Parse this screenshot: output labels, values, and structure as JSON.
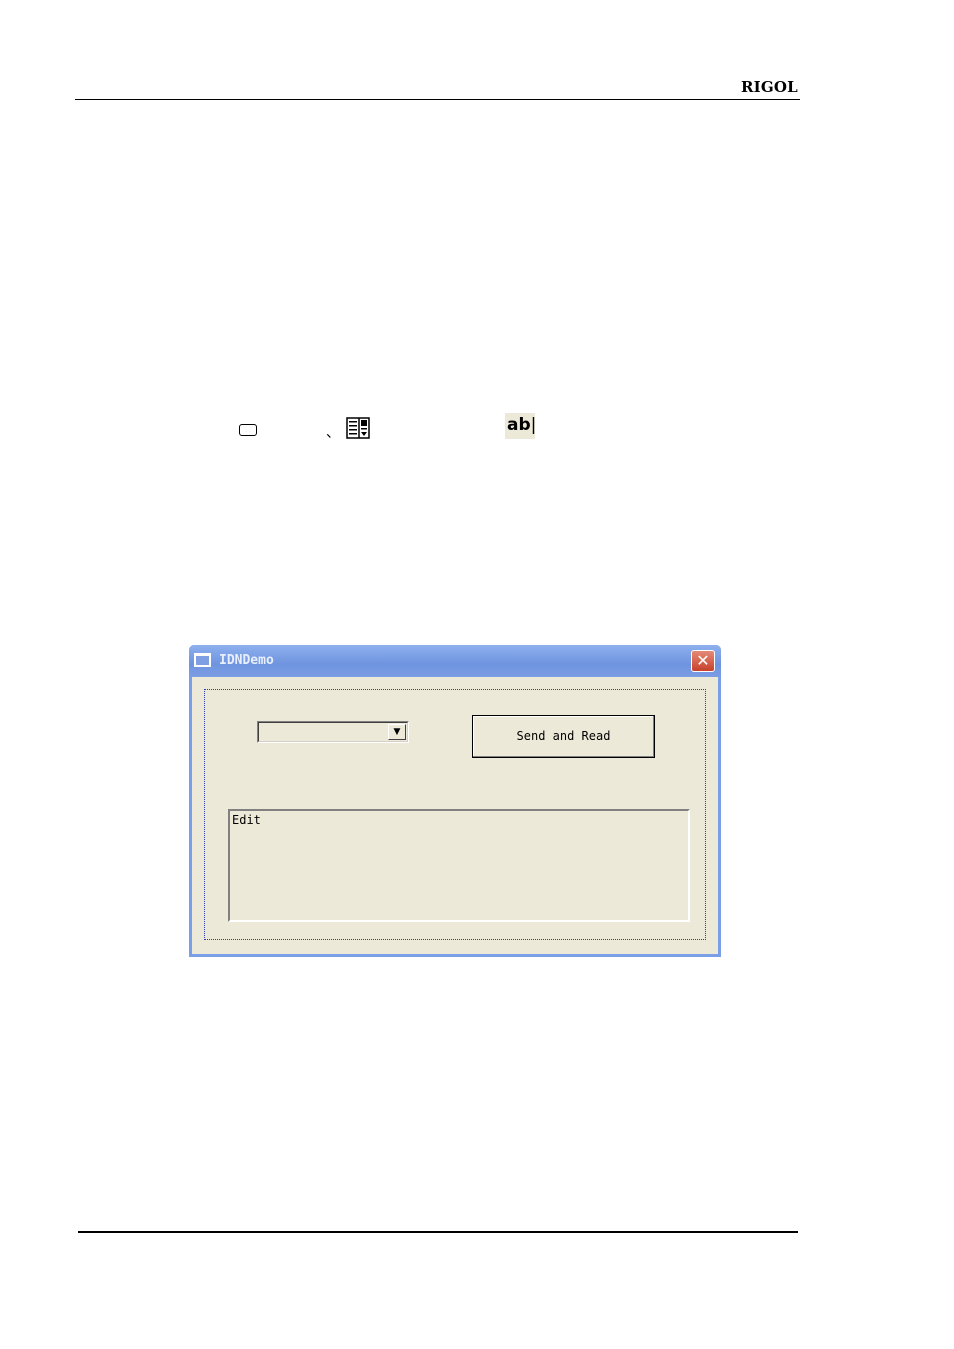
{
  "header": {
    "brand": "RIGOL"
  },
  "toolbox_icons": {
    "separator": "、",
    "edit_icon_text": "ab",
    "edit_icon_caret": "|",
    "icons": [
      "button-control-icon",
      "combobox-control-icon",
      "edit-control-icon"
    ]
  },
  "dialog": {
    "title": "IDNDemo",
    "close_glyph": "✕",
    "combo": {
      "value": "",
      "arrow": "▼"
    },
    "send_button_label": "Send and Read",
    "edit_text": "Edit",
    "colors": {
      "titlebar": "#7b9de4",
      "client": "#ece9d8",
      "close": "#c7412c"
    }
  }
}
